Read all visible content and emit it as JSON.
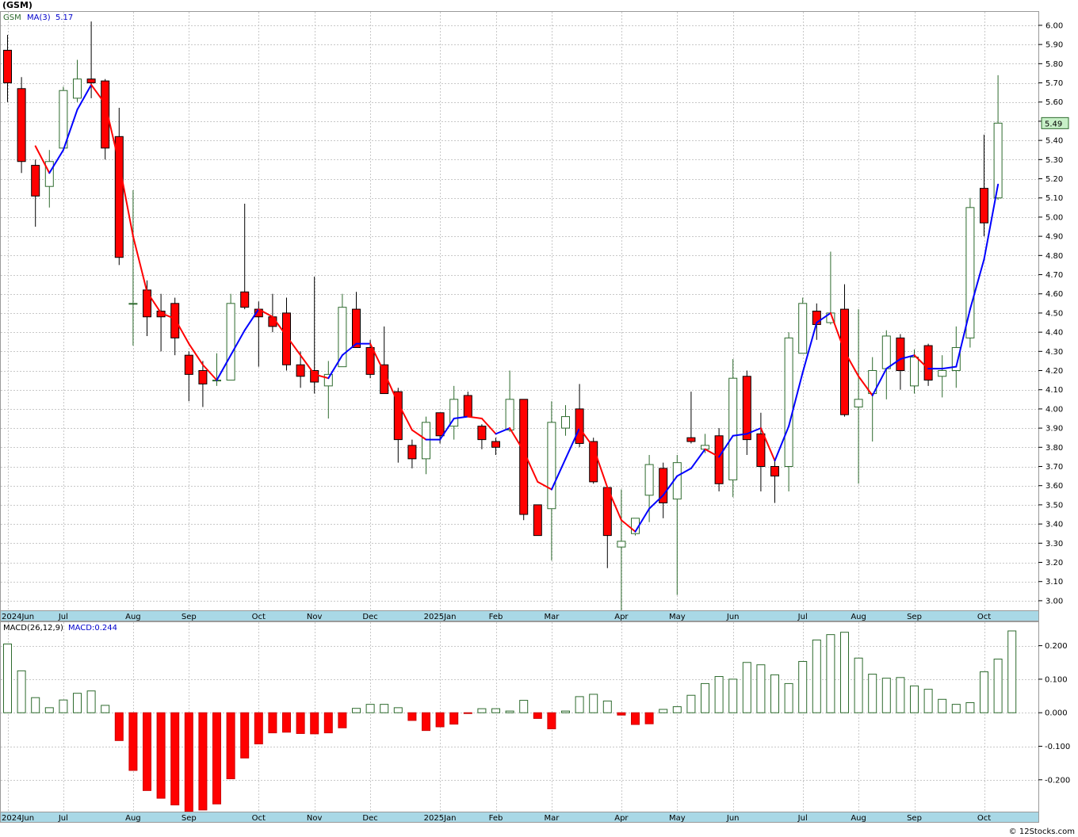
{
  "header": {
    "title": "(GSM)",
    "legend_symbol": "GSM",
    "ma_label": "MA(3)",
    "ma_value": "5.17",
    "last_price": "5.49"
  },
  "macd": {
    "label": "MACD(26,12,9)",
    "value_label": "MACD:0.244"
  },
  "footer": {
    "credit": "© 12Stocks.com"
  },
  "colors": {
    "up_candle": "#2e6b2e",
    "down_candle": "#ff0000",
    "ma_up": "#0000ff",
    "ma_down": "#ff0000",
    "macd_pos": "#2e6b2e",
    "macd_neg": "#ff0000",
    "axis_bar": "#a9d8e6",
    "grid": "#c8c8c8"
  },
  "chart_data": [
    {
      "type": "candlestick",
      "title": "(GSM)",
      "period": "weekly",
      "ylim": [
        2.95,
        6.07
      ],
      "y_ticks": [
        3.0,
        3.1,
        3.2,
        3.3,
        3.4,
        3.5,
        3.6,
        3.7,
        3.8,
        3.9,
        4.0,
        4.1,
        4.2,
        4.3,
        4.4,
        4.5,
        4.6,
        4.7,
        4.8,
        4.9,
        5.0,
        5.1,
        5.2,
        5.3,
        5.4,
        5.5,
        5.6,
        5.7,
        5.8,
        5.9,
        6.0
      ],
      "x_labels": [
        {
          "i": 0,
          "label": "2024Jun"
        },
        {
          "i": 4,
          "label": "Jul"
        },
        {
          "i": 9,
          "label": "Aug"
        },
        {
          "i": 13,
          "label": "Sep"
        },
        {
          "i": 18,
          "label": "Oct"
        },
        {
          "i": 22,
          "label": "Nov"
        },
        {
          "i": 26,
          "label": "Dec"
        },
        {
          "i": 31,
          "label": "2025Jan"
        },
        {
          "i": 35,
          "label": "Feb"
        },
        {
          "i": 39,
          "label": "Mar"
        },
        {
          "i": 44,
          "label": "Apr"
        },
        {
          "i": 48,
          "label": "May"
        },
        {
          "i": 52,
          "label": "Jun"
        },
        {
          "i": 57,
          "label": "Jul"
        },
        {
          "i": 61,
          "label": "Aug"
        },
        {
          "i": 65,
          "label": "Sep"
        },
        {
          "i": 70,
          "label": "Oct"
        }
      ],
      "ohlc": [
        [
          5.87,
          5.95,
          5.6,
          5.7
        ],
        [
          5.67,
          5.73,
          5.23,
          5.29
        ],
        [
          5.27,
          5.3,
          4.95,
          5.11
        ],
        [
          5.16,
          5.35,
          5.05,
          5.29
        ],
        [
          5.36,
          5.68,
          5.36,
          5.66
        ],
        [
          5.62,
          5.82,
          5.6,
          5.72
        ],
        [
          5.72,
          6.02,
          5.62,
          5.7
        ],
        [
          5.71,
          5.72,
          5.3,
          5.36
        ],
        [
          5.42,
          5.57,
          4.75,
          4.79
        ],
        [
          4.55,
          5.14,
          4.33,
          4.55
        ],
        [
          4.62,
          4.67,
          4.38,
          4.48
        ],
        [
          4.51,
          4.6,
          4.3,
          4.48
        ],
        [
          4.55,
          4.58,
          4.28,
          4.37
        ],
        [
          4.28,
          4.3,
          4.04,
          4.18
        ],
        [
          4.2,
          4.25,
          4.01,
          4.13
        ],
        [
          4.15,
          4.29,
          4.12,
          4.15
        ],
        [
          4.15,
          4.6,
          4.15,
          4.55
        ],
        [
          4.61,
          5.07,
          4.52,
          4.53
        ],
        [
          4.52,
          4.56,
          4.22,
          4.48
        ],
        [
          4.48,
          4.6,
          4.4,
          4.43
        ],
        [
          4.5,
          4.58,
          4.2,
          4.23
        ],
        [
          4.23,
          4.3,
          4.11,
          4.17
        ],
        [
          4.2,
          4.69,
          4.08,
          4.14
        ],
        [
          4.12,
          4.25,
          3.95,
          4.18
        ],
        [
          4.22,
          4.6,
          4.22,
          4.53
        ],
        [
          4.52,
          4.61,
          4.32,
          4.32
        ],
        [
          4.32,
          4.36,
          4.16,
          4.18
        ],
        [
          4.23,
          4.43,
          4.12,
          4.08
        ],
        [
          4.09,
          4.11,
          3.72,
          3.84
        ],
        [
          3.81,
          3.84,
          3.69,
          3.74
        ],
        [
          3.74,
          3.96,
          3.66,
          3.93
        ],
        [
          3.98,
          3.98,
          3.82,
          3.86
        ],
        [
          3.91,
          4.12,
          3.84,
          4.05
        ],
        [
          4.07,
          4.09,
          3.97,
          3.96
        ],
        [
          3.91,
          3.92,
          3.79,
          3.84
        ],
        [
          3.83,
          3.85,
          3.76,
          3.8
        ],
        [
          3.89,
          4.2,
          3.88,
          4.05
        ],
        [
          4.05,
          4.05,
          3.42,
          3.45
        ],
        [
          3.5,
          3.5,
          3.35,
          3.34
        ],
        [
          3.48,
          4.04,
          3.21,
          3.93
        ],
        [
          3.9,
          4.02,
          3.86,
          3.96
        ],
        [
          4.0,
          4.13,
          3.8,
          3.82
        ],
        [
          3.83,
          3.85,
          3.61,
          3.62
        ],
        [
          3.59,
          3.59,
          3.17,
          3.34
        ],
        [
          3.28,
          3.58,
          2.95,
          3.31
        ],
        [
          3.35,
          3.42,
          3.34,
          3.43
        ],
        [
          3.55,
          3.76,
          3.41,
          3.71
        ],
        [
          3.69,
          3.72,
          3.43,
          3.51
        ],
        [
          3.53,
          3.76,
          3.03,
          3.72
        ],
        [
          3.85,
          4.09,
          3.82,
          3.83
        ],
        [
          3.79,
          3.87,
          3.77,
          3.81
        ],
        [
          3.86,
          3.9,
          3.57,
          3.61
        ],
        [
          3.63,
          4.26,
          3.54,
          4.16
        ],
        [
          4.17,
          4.2,
          3.76,
          3.84
        ],
        [
          3.87,
          3.98,
          3.57,
          3.7
        ],
        [
          3.7,
          3.74,
          3.51,
          3.65
        ],
        [
          3.7,
          4.4,
          3.57,
          4.37
        ],
        [
          4.29,
          4.58,
          4.29,
          4.55
        ],
        [
          4.51,
          4.55,
          4.36,
          4.44
        ],
        [
          4.45,
          4.82,
          4.44,
          4.5
        ],
        [
          4.52,
          4.65,
          3.96,
          3.97
        ],
        [
          4.01,
          4.52,
          3.61,
          4.05
        ],
        [
          4.08,
          4.27,
          3.83,
          4.2
        ],
        [
          4.21,
          4.41,
          4.05,
          4.38
        ],
        [
          4.37,
          4.39,
          4.1,
          4.2
        ],
        [
          4.12,
          4.31,
          4.08,
          4.27
        ],
        [
          4.33,
          4.34,
          4.12,
          4.15
        ],
        [
          4.17,
          4.28,
          4.06,
          4.2
        ],
        [
          4.2,
          4.43,
          4.11,
          4.32
        ],
        [
          4.37,
          5.1,
          4.32,
          5.05
        ],
        [
          5.15,
          5.43,
          4.9,
          4.97
        ],
        [
          5.1,
          5.74,
          5.09,
          5.49
        ]
      ],
      "ma3": [
        null,
        null,
        5.37,
        5.23,
        5.35,
        5.56,
        5.69,
        5.59,
        5.28,
        4.9,
        4.61,
        4.5,
        4.47,
        4.34,
        4.23,
        4.15,
        4.28,
        4.41,
        4.52,
        4.48,
        4.38,
        4.28,
        4.18,
        4.16,
        4.28,
        4.34,
        4.34,
        4.19,
        4.03,
        3.89,
        3.84,
        3.84,
        3.95,
        3.96,
        3.95,
        3.87,
        3.9,
        3.78,
        3.62,
        3.58,
        3.74,
        3.9,
        3.8,
        3.59,
        3.42,
        3.36,
        3.48,
        3.55,
        3.65,
        3.69,
        3.79,
        3.75,
        3.86,
        3.87,
        3.9,
        3.73,
        3.91,
        4.19,
        4.45,
        4.5,
        4.3,
        4.17,
        4.07,
        4.21,
        4.26,
        4.28,
        4.21,
        4.21,
        4.22,
        4.52,
        4.78,
        5.17
      ]
    },
    {
      "type": "bar",
      "title": "MACD(26,12,9)",
      "ylim": [
        -0.295,
        0.27
      ],
      "y_ticks": [
        -0.2,
        -0.1,
        0.0,
        0.1,
        0.2
      ],
      "values": [
        0.205,
        0.125,
        0.045,
        0.015,
        0.038,
        0.058,
        0.065,
        0.022,
        -0.083,
        -0.172,
        -0.232,
        -0.255,
        -0.275,
        -0.295,
        -0.29,
        -0.272,
        -0.197,
        -0.135,
        -0.093,
        -0.06,
        -0.058,
        -0.062,
        -0.063,
        -0.06,
        -0.045,
        0.013,
        0.025,
        0.025,
        0.015,
        -0.023,
        -0.053,
        -0.042,
        -0.034,
        -0.002,
        0.012,
        0.012,
        0.005,
        0.037,
        -0.017,
        -0.048,
        0.005,
        0.048,
        0.055,
        0.035,
        -0.007,
        -0.035,
        -0.033,
        0.01,
        0.018,
        0.052,
        0.087,
        0.108,
        0.1,
        0.15,
        0.143,
        0.113,
        0.087,
        0.153,
        0.217,
        0.233,
        0.24,
        0.163,
        0.115,
        0.103,
        0.105,
        0.08,
        0.07,
        0.04,
        0.025,
        0.03,
        0.122,
        0.16,
        0.244
      ]
    }
  ]
}
